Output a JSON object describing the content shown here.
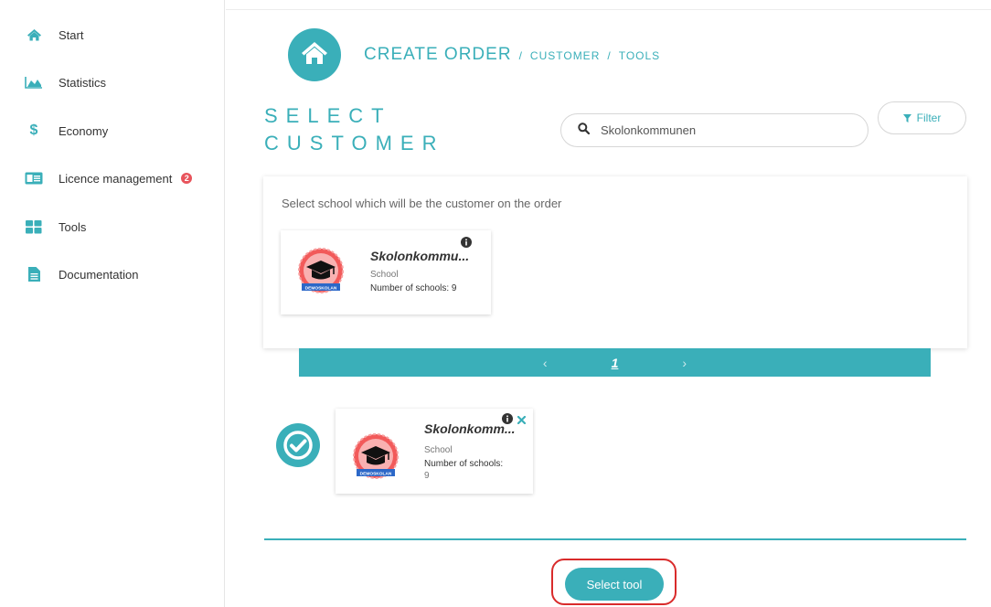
{
  "sidebar": {
    "items": [
      {
        "label": "Start",
        "icon": "home-icon"
      },
      {
        "label": "Statistics",
        "icon": "area-chart-icon"
      },
      {
        "label": "Economy",
        "icon": "dollar-icon"
      },
      {
        "label": "Licence management",
        "icon": "id-card-icon",
        "badge": "2"
      },
      {
        "label": "Tools",
        "icon": "grid-icon"
      },
      {
        "label": "Documentation",
        "icon": "file-icon"
      }
    ]
  },
  "header": {
    "breadcrumb_main": "CREATE ORDER",
    "breadcrumb_sep1": "/",
    "breadcrumb_customer": "CUSTOMER",
    "breadcrumb_sep2": "/",
    "breadcrumb_tools": "TOOLS"
  },
  "select_title_line1": "SELECT",
  "select_title_line2": "CUSTOMER",
  "search": {
    "value": "Skolonkommunen"
  },
  "filter": {
    "label": "Filter"
  },
  "panel": {
    "instruction": "Select school which will be the customer on the order",
    "result_card": {
      "name": "Skolonkommu...",
      "type": "School",
      "count_text": "Number of schools: 9",
      "logo_text": "DEMOSKOLAN"
    }
  },
  "pagination": {
    "prev": "‹",
    "page": "1",
    "next": "›"
  },
  "selected_card": {
    "name": "Skolonkomm...",
    "type": "School",
    "count_line1": "Number of schools:",
    "count_line2": "9",
    "logo_text": "DEMOSKOLAN"
  },
  "actions": {
    "select_tool": "Select tool"
  },
  "colors": {
    "accent": "#3aafb9",
    "badge": "#e8545c",
    "highlight": "#d92b2b"
  }
}
